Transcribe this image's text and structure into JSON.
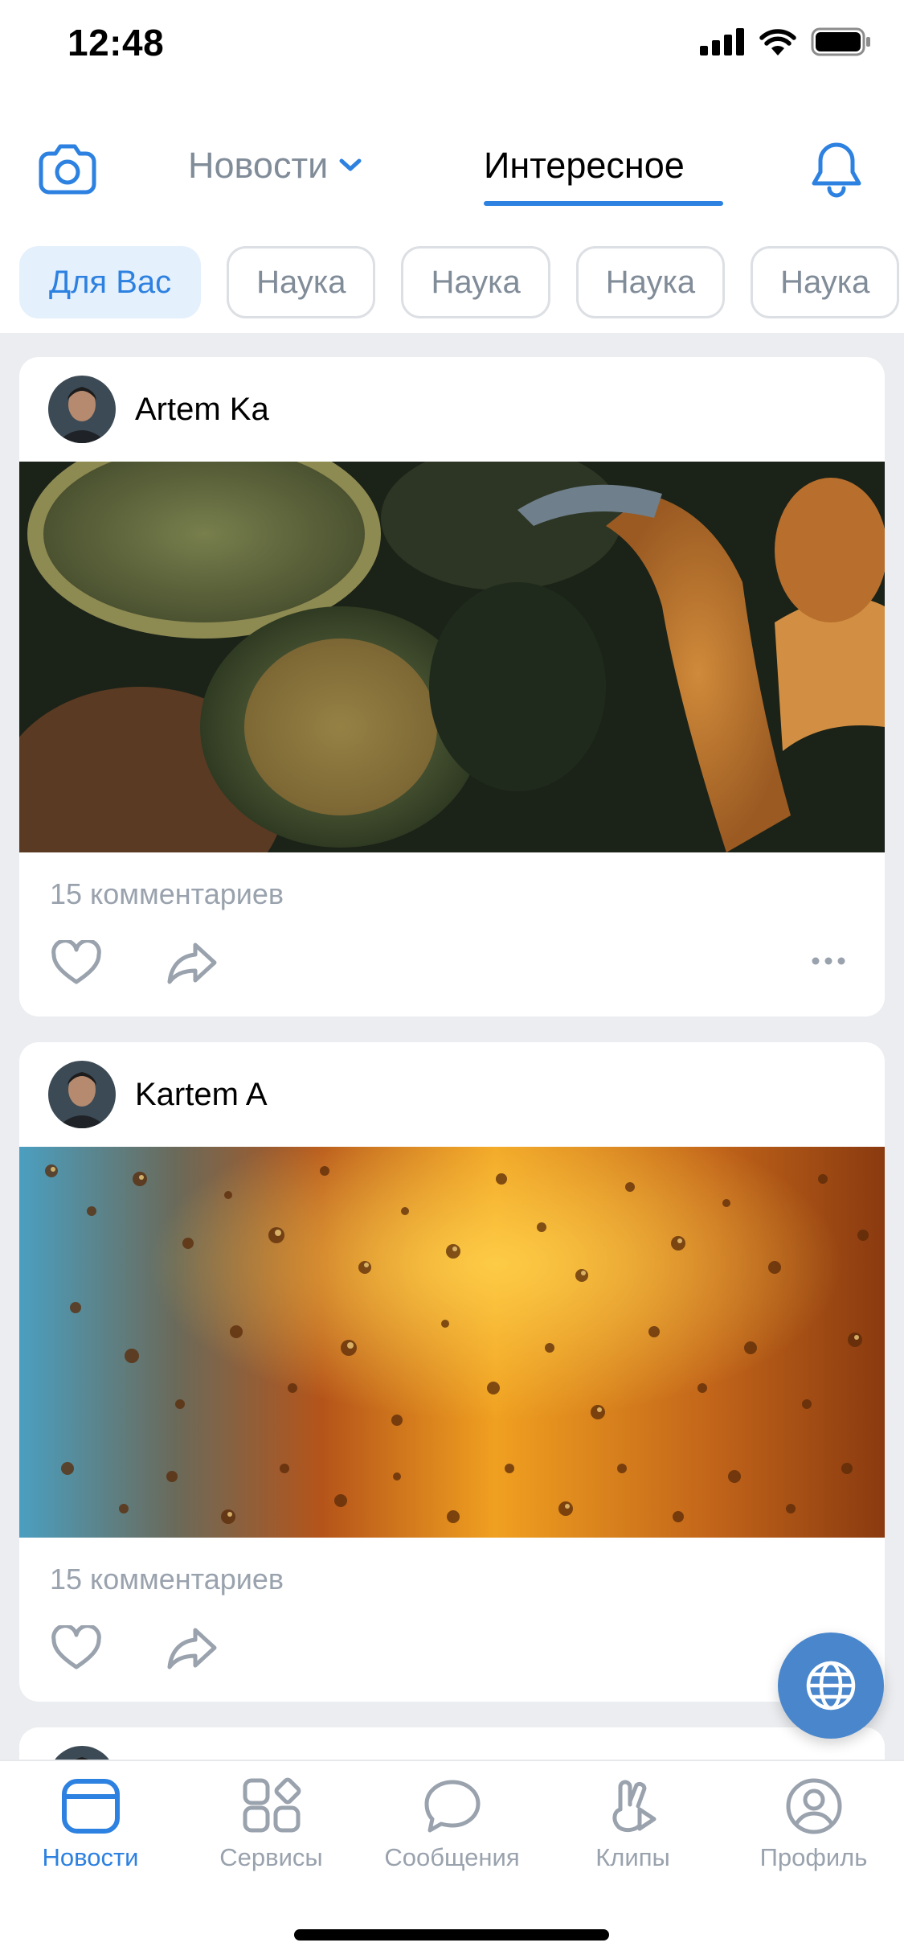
{
  "status_bar": {
    "time": "12:48"
  },
  "header": {
    "tab_news": "Новости",
    "tab_interesting": "Интересное"
  },
  "chips": [
    "Для Вас",
    "Наука",
    "Наука",
    "Наука",
    "Наука"
  ],
  "posts": [
    {
      "author": "Artem Ka",
      "comments": "15 комментариев"
    },
    {
      "author": "Kartem A",
      "comments": "15 комментариев"
    }
  ],
  "tabbar": {
    "news": "Новости",
    "services": "Сервисы",
    "messages": "Сообщения",
    "clips": "Клипы",
    "profile": "Профиль"
  },
  "colors": {
    "accent": "#2d81e0",
    "fab": "#4986cc",
    "feed_bg": "#ebedf0",
    "secondary_text": "#99a2ad"
  }
}
